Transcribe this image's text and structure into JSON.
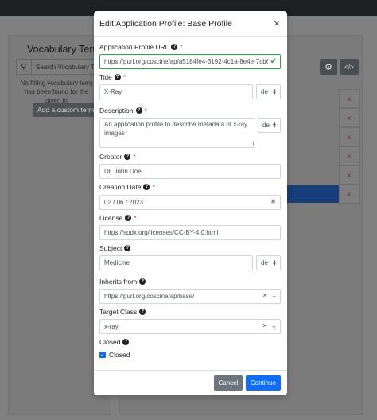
{
  "background": {
    "vocab_title": "Vocabulary Term",
    "search_placeholder": "Search Vocabulary T",
    "no_fitting_text": "No fitting vocabulary term has been found for the given in",
    "add_custom_term": "Add a custom term",
    "gear_icon": "gear-icon",
    "code_icon": "</>",
    "remove_mark": "x"
  },
  "modal": {
    "title": "Edit Application Profile: Base Profile",
    "close_label": "×",
    "fields": {
      "url": {
        "label": "Application Profile URL",
        "required": "*",
        "value": "https://purl.org/coscine/ap/a5184fe4-3192-4c1a-8e4e-7cb6"
      },
      "title": {
        "label": "Title",
        "required": "*",
        "value": "X-Ray",
        "lang": "de"
      },
      "description": {
        "label": "Description",
        "required": "*",
        "value": "An application profile to describe metadata of x-ray images",
        "lang": "de"
      },
      "creator": {
        "label": "Creator",
        "required": "*",
        "value": "Dr. John Doe"
      },
      "creation_date": {
        "label": "Creation Date",
        "required": "*",
        "value": "02 / 06 / 2023"
      },
      "license": {
        "label": "License",
        "required": "*",
        "value": "https://spdx.org/licenses/CC-BY-4.0.html"
      },
      "subject": {
        "label": "Subject",
        "value": "Medicine",
        "lang": "de"
      },
      "inherits_from": {
        "label": "Inherits from",
        "value": "https://purl.org/coscine/ap/base/"
      },
      "target_class": {
        "label": "Target Class",
        "value": "x-ray"
      },
      "closed": {
        "label": "Closed",
        "checkbox_label": "Closed",
        "checked": true
      }
    },
    "footer": {
      "cancel_label": "Cancel",
      "continue_label": "Continue"
    }
  },
  "colors": {
    "primary": "#0d6efd",
    "valid": "#28a745",
    "required": "#dc3545",
    "secondary": "#6c757d"
  }
}
